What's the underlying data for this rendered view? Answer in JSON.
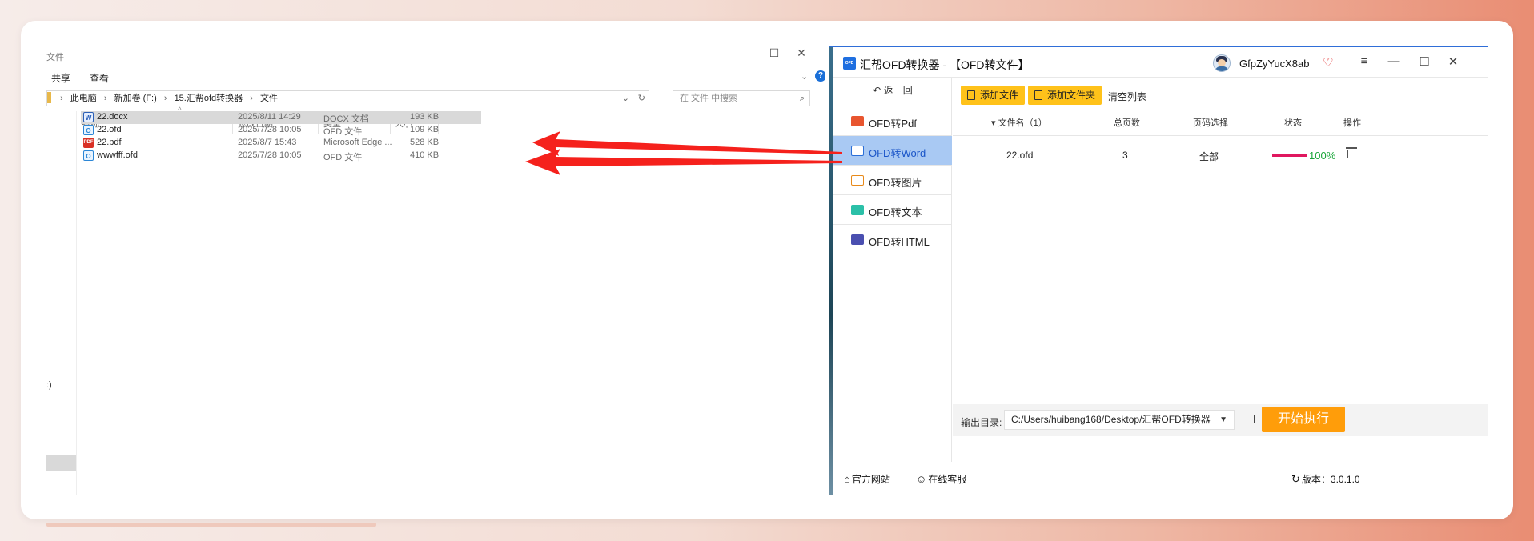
{
  "explorer": {
    "title": "文件",
    "window_controls": [
      "—",
      "☐",
      "✕"
    ],
    "menu": [
      "共享",
      "查看"
    ],
    "address": [
      "此电脑",
      "新加卷 (F:)",
      "15.汇帮ofd转换器",
      "文件"
    ],
    "search_placeholder": "在 文件 中搜索",
    "nav_text": ":)",
    "columns": [
      "名称",
      "修改日期",
      "类型",
      "大小"
    ],
    "files": [
      {
        "name": "22.docx",
        "date": "2025/8/11 14:29",
        "type": "DOCX 文档",
        "size": "193 KB",
        "icon": "W"
      },
      {
        "name": "22.ofd",
        "date": "2025/7/28 10:05",
        "type": "OFD 文件",
        "size": "109 KB",
        "icon": "O"
      },
      {
        "name": "22.pdf",
        "date": "2025/8/7 15:43",
        "type": "Microsoft Edge ...",
        "size": "528 KB",
        "icon": "PDF"
      },
      {
        "name": "wwwfff.ofd",
        "date": "2025/7/28 10:05",
        "type": "OFD 文件",
        "size": "410 KB",
        "icon": "O"
      }
    ]
  },
  "app": {
    "logo": "OFD",
    "title": "汇帮OFD转换器 - 【OFD转文件】",
    "username": "GfpZyYucX8ab",
    "vip_icon": "♡",
    "controls": [
      "≡",
      "—",
      "☐",
      "✕"
    ],
    "back_label": "返　回",
    "nav": [
      {
        "label": "OFD转Pdf",
        "color": "#e8552f"
      },
      {
        "label": "OFD转Word",
        "color": "#2b6fd8"
      },
      {
        "label": "OFD转图片",
        "color": "#e88a1a"
      },
      {
        "label": "OFD转文本",
        "color": "#2bc0a8"
      },
      {
        "label": "OFD转HTML",
        "color": "#4a4fb0"
      }
    ],
    "buttons": {
      "add_file": "添加文件",
      "add_folder": "添加文件夹",
      "clear_list": "清空列表"
    },
    "table": {
      "headers": [
        "▾ 文件名（1）",
        "总页数",
        "页码选择",
        "状态",
        "操作"
      ],
      "rows": [
        {
          "name": "22.ofd",
          "pages": "3",
          "range": "全部",
          "progress": 1.0,
          "status": "100%"
        }
      ]
    },
    "output_label": "输出目录:",
    "output_path": "C:/Users/huibang168/Desktop/汇帮OFD转换器",
    "start_label": "开始执行",
    "footer": {
      "website": "官方网站",
      "service": "在线客服",
      "version": "版本：3.0.1.0"
    }
  }
}
